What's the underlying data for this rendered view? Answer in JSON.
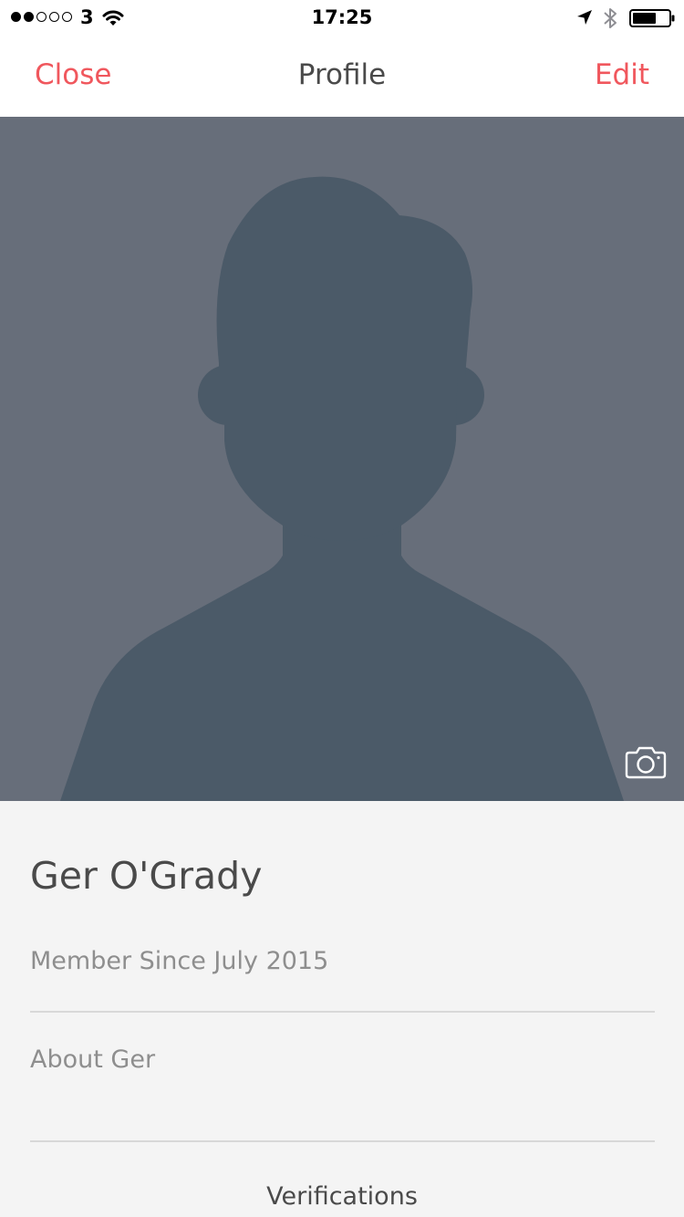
{
  "status_bar": {
    "signal_strength": "2 of 5",
    "carrier": "3",
    "time": "17:25",
    "icons": [
      "wifi-icon",
      "location-icon",
      "bluetooth-icon",
      "battery-icon"
    ],
    "battery_level": 0.65
  },
  "nav": {
    "close_label": "Close",
    "title": "Profile",
    "edit_label": "Edit"
  },
  "photo": {
    "placeholder": "avatar-silhouette",
    "change_photo_icon": "camera-icon"
  },
  "profile": {
    "name": "Ger O'Grady",
    "member_since": "Member Since July 2015",
    "about_label": "About Ger",
    "verifications_label": "Verifications"
  },
  "colors": {
    "accent": "#f0575d",
    "photo_background": "#676e7a",
    "silhouette": "#4b5a68",
    "details_background": "#f4f4f4",
    "primary_text": "#4a4a4a",
    "secondary_text": "#8e8e8e"
  }
}
